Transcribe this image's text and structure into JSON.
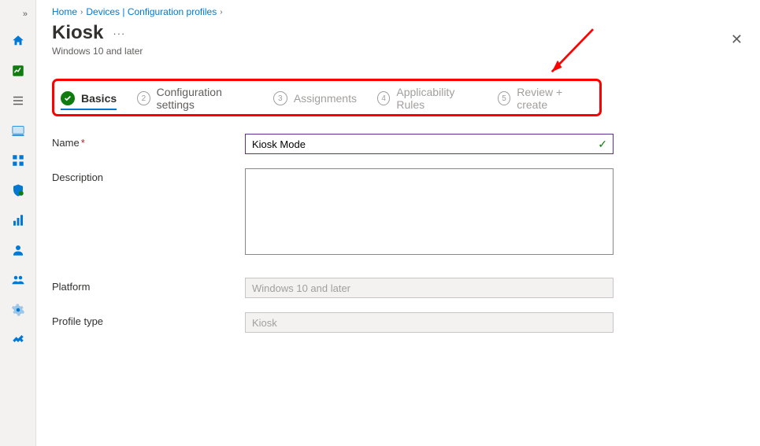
{
  "breadcrumb": {
    "home": "Home",
    "devices": "Devices | Configuration profiles"
  },
  "header": {
    "title": "Kiosk",
    "subtitle": "Windows 10 and later"
  },
  "stepper": {
    "s1": "Basics",
    "s2": "Configuration settings",
    "s3": "Assignments",
    "s4": "Applicability Rules",
    "s5": "Review + create",
    "n2": "2",
    "n3": "3",
    "n4": "4",
    "n5": "5"
  },
  "form": {
    "name_label": "Name",
    "name_value": "Kiosk Mode",
    "description_label": "Description",
    "description_value": "",
    "platform_label": "Platform",
    "platform_value": "Windows 10 and later",
    "profile_type_label": "Profile type",
    "profile_type_value": "Kiosk"
  },
  "sidebar": {
    "items": [
      {
        "name": "home-icon"
      },
      {
        "name": "dashboard-icon"
      },
      {
        "name": "all-services-icon"
      },
      {
        "name": "devices-icon"
      },
      {
        "name": "apps-icon"
      },
      {
        "name": "endpoint-security-icon"
      },
      {
        "name": "reports-icon"
      },
      {
        "name": "users-icon"
      },
      {
        "name": "groups-icon"
      },
      {
        "name": "tenant-admin-icon"
      },
      {
        "name": "troubleshooting-icon"
      }
    ]
  }
}
